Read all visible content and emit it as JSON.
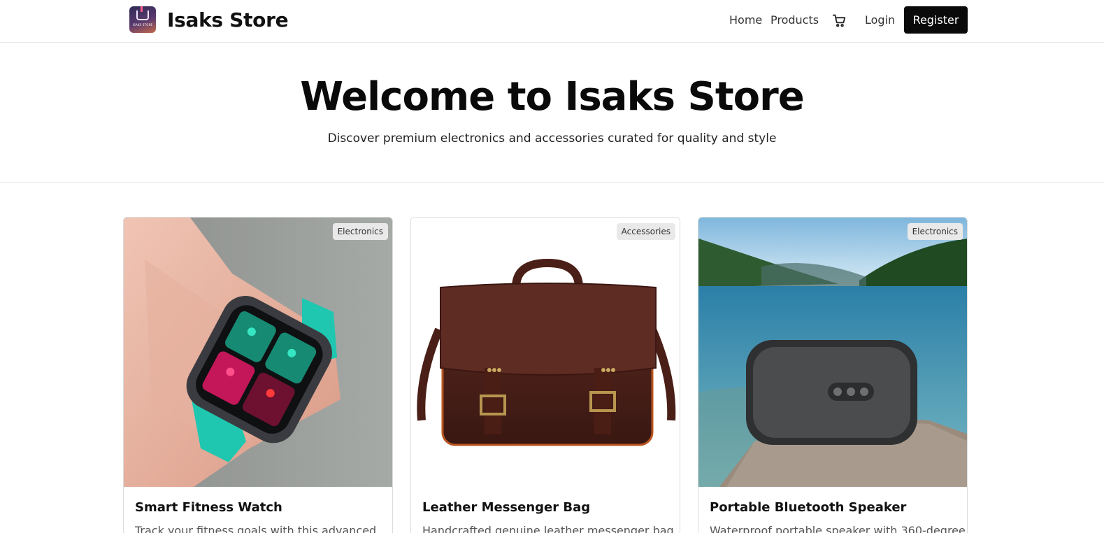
{
  "header": {
    "logo_text": "ISAKS STORE",
    "brand": "Isaks Store",
    "nav": {
      "home": "Home",
      "products": "Products",
      "login": "Login",
      "register": "Register"
    },
    "cart_icon": "shopping-cart-icon"
  },
  "hero": {
    "title": "Welcome to Isaks Store",
    "subtitle": "Discover premium electronics and accessories curated for quality and style"
  },
  "products": [
    {
      "category": "Electronics",
      "name": "Smart Fitness Watch",
      "description": "Track your fitness goals with this advanced",
      "image": "smart-watch-on-wrist"
    },
    {
      "category": "Accessories",
      "name": "Leather Messenger Bag",
      "description": "Handcrafted genuine leather messenger bag",
      "image": "brown-leather-messenger-bag"
    },
    {
      "category": "Electronics",
      "name": "Portable Bluetooth Speaker",
      "description": "Waterproof portable speaker with 360-degree",
      "image": "speaker-on-rock-by-lake"
    }
  ],
  "colors": {
    "primary_button": "#0a0a0a",
    "badge_bg": "#e9e9ea",
    "border": "#e5e5e5"
  }
}
